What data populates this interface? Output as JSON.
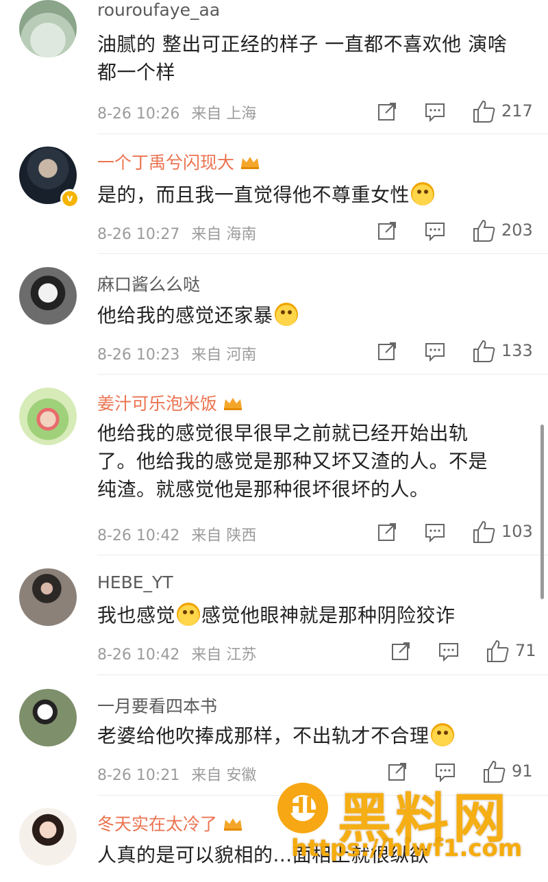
{
  "comments": [
    {
      "user": "rouroufaye_aa",
      "vip": false,
      "verified": false,
      "lines": [
        "油腻的 整出可正经的样子 一直都不喜欢他 演啥",
        "都一个样"
      ],
      "emoji_after": null,
      "time": "8-26 10:26",
      "from": "来自",
      "location": "上海",
      "likes": "217"
    },
    {
      "user": "一个丁禹兮闪现大",
      "vip": true,
      "verified": true,
      "lines": [
        "是的，而且我一直觉得他不尊重女性"
      ],
      "emoji_after": "laugh-cry",
      "time": "8-26 10:27",
      "from": "来自",
      "location": "海南",
      "likes": "203"
    },
    {
      "user": "麻口酱么么哒",
      "vip": false,
      "verified": false,
      "lines": [
        "他给我的感觉还家暴"
      ],
      "emoji_after": "tear",
      "time": "8-26 10:23",
      "from": "来自",
      "location": "河南",
      "likes": "133"
    },
    {
      "user": "姜汁可乐泡米饭",
      "vip": true,
      "verified": false,
      "lines": [
        "他给我的感觉很早很早之前就已经开始出轨",
        "了。他给我的感觉是那种又坏又渣的人。不是",
        "纯渣。就感觉他是那种很坏很坏的人。"
      ],
      "emoji_after": null,
      "time": "8-26 10:42",
      "from": "来自",
      "location": "陕西",
      "likes": "103"
    },
    {
      "user": "HEBE_YT",
      "vip": false,
      "verified": false,
      "text_before": "我也感觉",
      "text_after": "感觉他眼神就是那种阴险狡诈",
      "emoji_mid": "laugh-cry",
      "time": "8-26 10:42",
      "from": "来自",
      "location": "江苏",
      "likes": "71"
    },
    {
      "user": "一月要看四本书",
      "vip": false,
      "verified": false,
      "lines": [
        "老婆给他吹捧成那样，不出轨才不合理"
      ],
      "emoji_after": "laugh-cry",
      "time": "8-26 10:21",
      "from": "来自",
      "location": "安徽",
      "likes": "91"
    },
    {
      "user": "冬天实在太冷了",
      "vip": true,
      "verified": false,
      "lines": [
        "人真的是可以貌相的...面相上就很纵欲"
      ],
      "emoji_after": null
    }
  ],
  "watermark": {
    "title": "黑料网",
    "url": "https://hlwf1.com"
  },
  "icons": {
    "share": "share-icon",
    "comment": "comment-icon",
    "like": "like-icon",
    "vip": "crown-icon",
    "verified": "verified-badge-icon"
  },
  "colors": {
    "vip_name": "#eb7350",
    "normal_name": "#5a5a5a",
    "meta": "#9b9b9b",
    "watermark": "#f5a800"
  }
}
